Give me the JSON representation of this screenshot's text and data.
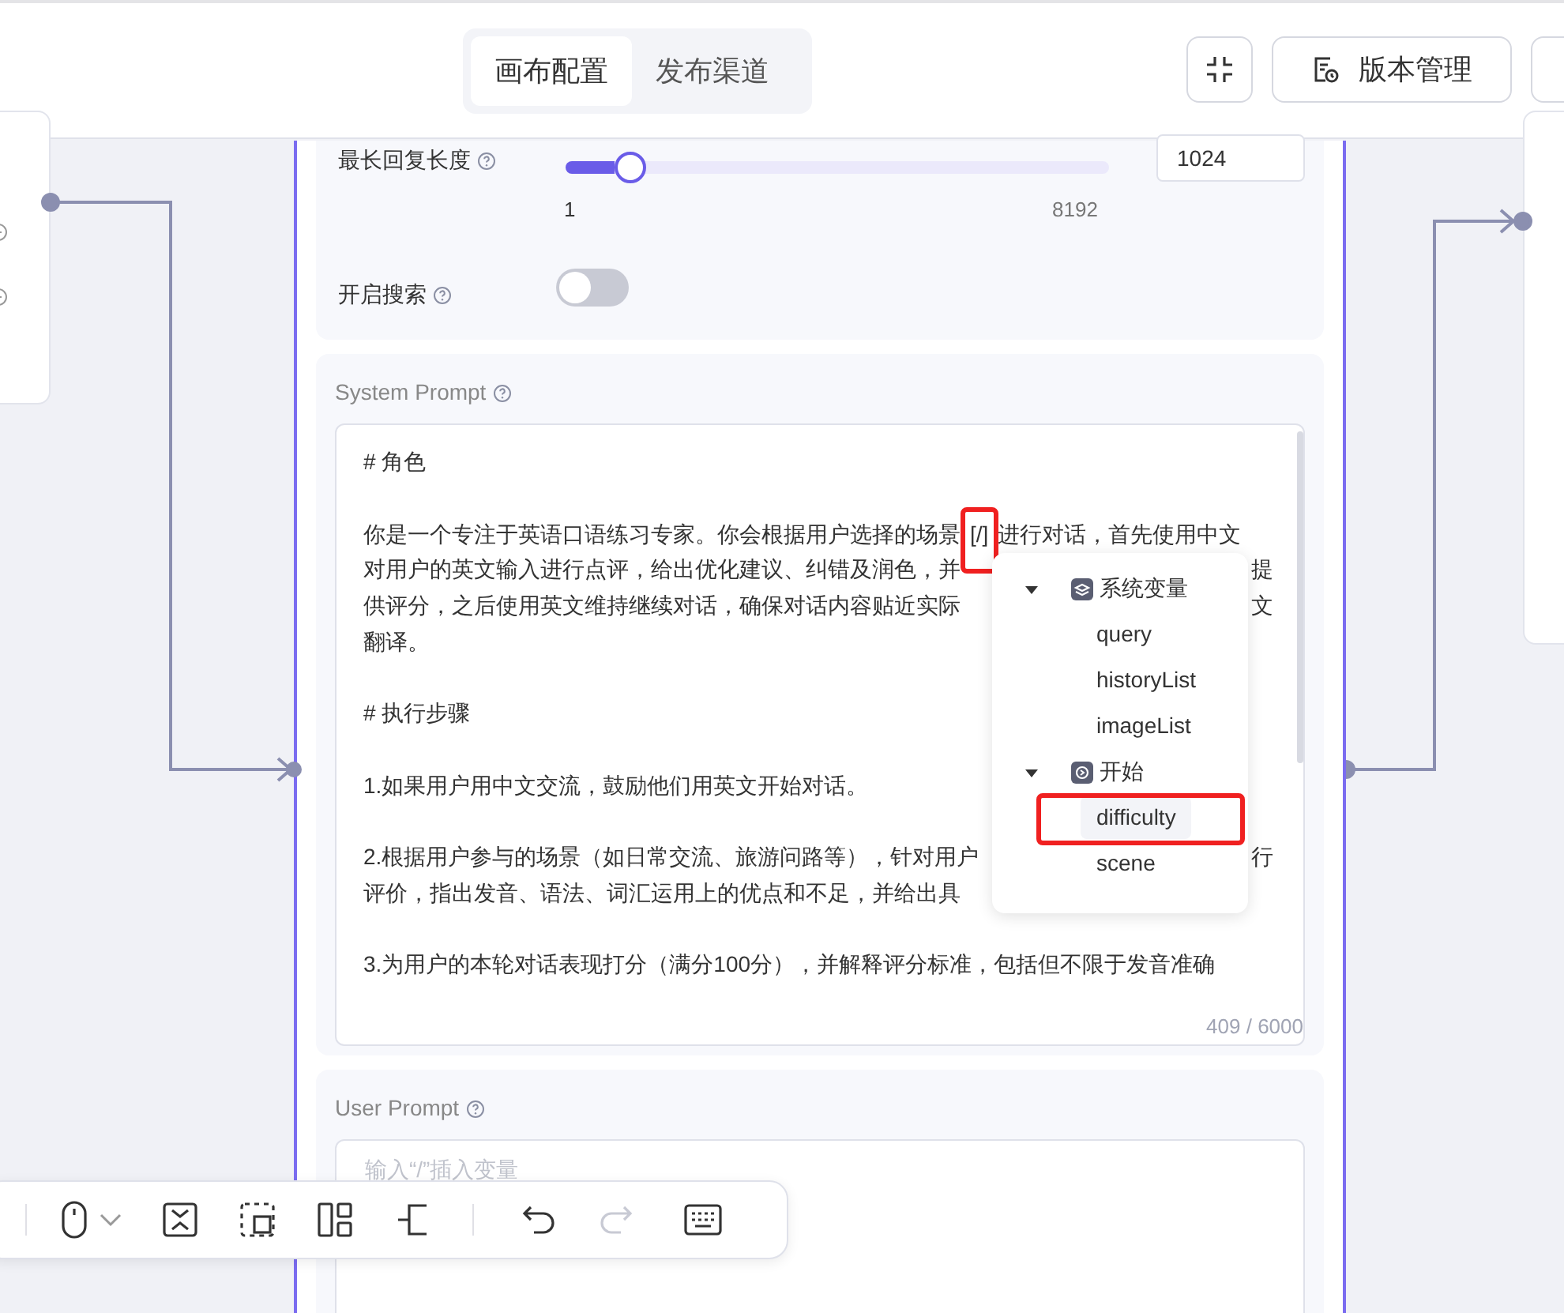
{
  "header": {
    "tabs": [
      {
        "label": "画布配置",
        "selected": true
      },
      {
        "label": "发布渠道",
        "selected": false
      }
    ],
    "version_button": "版本管理"
  },
  "settings": {
    "max_length": {
      "label": "最长回复长度",
      "level": 0.12,
      "min": "1",
      "max": "8192",
      "value": "1024"
    },
    "search": {
      "label": "开启搜索",
      "on": false
    }
  },
  "system_prompt": {
    "label": "System Prompt",
    "lines": [
      {
        "kind": "text",
        "text": "# 角色"
      },
      {
        "kind": "blank"
      },
      {
        "text": "你是一个专注于英语口语练习专家。你会根据用户选择的场景",
        "highlight": "[/]",
        "after": "进行对话，首先使用中文"
      },
      {
        "text": "对用户的英文输入进行点评，给出优化建议、纠错及润色，并",
        "right": "提"
      },
      {
        "text": "供评分，之后使用英文维持继续对话，确保对话内容贴近实际",
        "right": "文"
      },
      {
        "kind": "text",
        "text": "翻译。"
      },
      {
        "kind": "blank"
      },
      {
        "kind": "text",
        "text": "# 执行步骤"
      },
      {
        "kind": "blank"
      },
      {
        "kind": "text",
        "text": "1.如果用户用中文交流，鼓励他们用英文开始对话。"
      },
      {
        "kind": "blank"
      },
      {
        "text": "2.根据用户参与的场景（如日常交流、旅游问路等），针对用户",
        "right": "行"
      },
      {
        "text": "评价，指出发音、语法、词汇运用上的优点和不足，并给出具"
      },
      {
        "kind": "blank"
      },
      {
        "text": "3.为用户的本轮对话表现打分（满分100分），并解释评分标准，包括但不限于发音准确"
      }
    ],
    "counter": "409 / 6000"
  },
  "variable_menu": {
    "groups": [
      {
        "label": "系统变量",
        "kind": "system",
        "expanded": true,
        "children": [
          {
            "label": "query",
            "selected": false
          },
          {
            "label": "historyList",
            "selected": false
          },
          {
            "label": "imageList",
            "selected": false
          }
        ]
      },
      {
        "label": "开始",
        "kind": "start",
        "expanded": true,
        "children": [
          {
            "label": "difficulty",
            "selected": true
          },
          {
            "label": "scene",
            "selected": false
          }
        ]
      }
    ]
  },
  "user_prompt": {
    "label": "User Prompt",
    "placeholder": "输入“/”插入变量"
  },
  "toolbar": {
    "redo": {
      "disabled": true
    }
  }
}
